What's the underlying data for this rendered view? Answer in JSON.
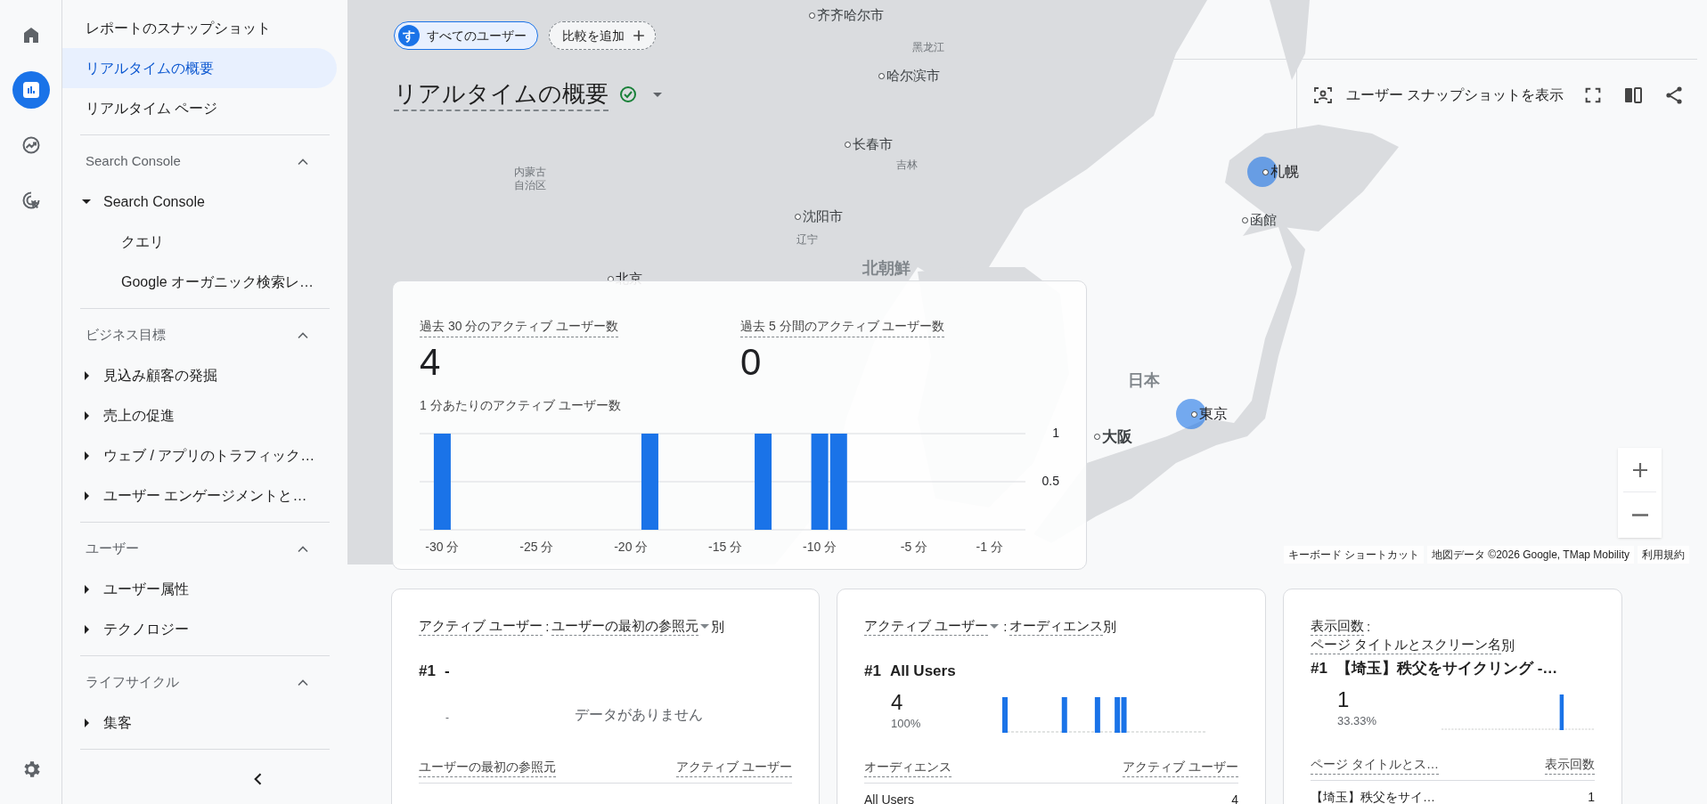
{
  "rail": {
    "items": [
      {
        "selected": false
      },
      {
        "selected": true
      },
      {
        "selected": false
      },
      {
        "selected": false
      },
      {
        "selected": false
      }
    ]
  },
  "nav": {
    "top_items": [
      {
        "label": "レポートのスナップショット",
        "selected": false
      },
      {
        "label": "リアルタイムの概要",
        "selected": true
      },
      {
        "label": "リアルタイム ページ",
        "selected": false
      }
    ],
    "sections": [
      {
        "title": "Search Console",
        "expanded": true,
        "items": [
          {
            "label": "Search Console",
            "expanded": true,
            "children": [
              {
                "label": "クエリ"
              },
              {
                "label": "Google オーガニック検索レ…"
              }
            ]
          }
        ]
      },
      {
        "title": "ビジネス目標",
        "expanded": true,
        "items": [
          {
            "label": "見込み顧客の発掘",
            "expanded": false
          },
          {
            "label": "売上の促進",
            "expanded": false
          },
          {
            "label": "ウェブ / アプリのトラフィック…",
            "expanded": false
          },
          {
            "label": "ユーザー エンゲージメントと…",
            "expanded": false
          }
        ]
      },
      {
        "title": "ユーザー",
        "expanded": true,
        "items": [
          {
            "label": "ユーザー属性",
            "expanded": false
          },
          {
            "label": "テクノロジー",
            "expanded": false
          }
        ]
      },
      {
        "title": "ライフサイクル",
        "expanded": true,
        "items": [
          {
            "label": "集客",
            "expanded": false
          }
        ]
      }
    ]
  },
  "header": {
    "segment": {
      "avatar_letter": "す",
      "label": "すべてのユーザー"
    },
    "add_comparison": "比較を追加",
    "title": "リアルタイムの概要",
    "user_snapshot": "ユーザー スナップショットを表示"
  },
  "map": {
    "labels": [
      {
        "text": "齐齐哈尔市",
        "kind": "city"
      },
      {
        "text": "黑龙江",
        "kind": "region"
      },
      {
        "text": "哈尔滨市",
        "kind": "city"
      },
      {
        "text": "长春市",
        "kind": "city"
      },
      {
        "text": "吉林",
        "kind": "region"
      },
      {
        "text": "内蒙古自治区",
        "kind": "region"
      },
      {
        "text": "沈阳市",
        "kind": "city"
      },
      {
        "text": "辽宁",
        "kind": "region"
      },
      {
        "text": "北京",
        "kind": "capital"
      },
      {
        "text": "北朝鮮",
        "kind": "country"
      },
      {
        "text": "札幌",
        "kind": "active_city"
      },
      {
        "text": "函館",
        "kind": "city"
      },
      {
        "text": "日本",
        "kind": "country"
      },
      {
        "text": "東京",
        "kind": "active_city"
      },
      {
        "text": "大阪",
        "kind": "major_city"
      }
    ],
    "attribution": [
      "キーボード ショートカット",
      "地図データ ©2026 Google, TMap Mobility",
      "利用規約"
    ]
  },
  "realtime_card": {
    "metrics": [
      {
        "label": "過去 30 分のアクティブ ユーザー数",
        "value": "4"
      },
      {
        "label": "過去 5 分間のアクティブ ユーザー数",
        "value": "0"
      }
    ],
    "chart_title": "1 分あたりのアクティブ ユーザー数",
    "chart_data": {
      "type": "bar",
      "x": [
        -30,
        -29,
        -28,
        -27,
        -26,
        -25,
        -24,
        -23,
        -22,
        -21,
        -20,
        -19,
        -18,
        -17,
        -16,
        -15,
        -14,
        -13,
        -12,
        -11,
        -10,
        -9,
        -8,
        -7,
        -6,
        -5,
        -4,
        -3,
        -2,
        -1
      ],
      "values": [
        1,
        0,
        0,
        0,
        0,
        0,
        0,
        0,
        0,
        0,
        0,
        1,
        0,
        0,
        0,
        0,
        0,
        1,
        0,
        0,
        1,
        1,
        0,
        0,
        0,
        0,
        0,
        0,
        0,
        0
      ],
      "xlim": [
        -31.2,
        0.9
      ],
      "ylim": [
        0,
        1
      ],
      "yticks": [
        {
          "value": 0.5,
          "label": "0.5"
        },
        {
          "value": 1,
          "label": "1"
        }
      ],
      "xticks": [
        {
          "value": -30,
          "label": "-30 分"
        },
        {
          "value": -25,
          "label": "-25 分"
        },
        {
          "value": -20,
          "label": "-20 分"
        },
        {
          "value": -15,
          "label": "-15 分"
        },
        {
          "value": -10,
          "label": "-10 分"
        },
        {
          "value": -5,
          "label": "-5 分"
        },
        {
          "value": -1,
          "label": "-1 分"
        }
      ]
    }
  },
  "cards": [
    {
      "metric": "アクティブ ユーザー",
      "separator": ":",
      "dimension": "ユーザーの最初の参照元",
      "suffix": "別",
      "metric_dropdown": false,
      "dimension_dropdown": true,
      "sparkline": false,
      "rank": "#1",
      "top_name": "-",
      "top_value": "-",
      "empty_text": "データがありません",
      "columns": [
        "ユーザーの最初の参照元",
        "アクティブ ユーザー"
      ]
    },
    {
      "metric": "アクティブ ユーザー",
      "separator": ":",
      "dimension": "オーディエンス",
      "suffix": "別",
      "metric_dropdown": true,
      "dimension_dropdown": false,
      "rank": "#1",
      "top_name": "All Users",
      "top_value": "4",
      "top_share": "100%",
      "sparkline": true,
      "columns": [
        "オーディエンス",
        "アクティブ ユーザー"
      ],
      "rows": [
        [
          "All Users",
          "4"
        ]
      ]
    },
    {
      "metric": "表示回数",
      "separator": ":",
      "dimension": "ページ タイトルとスクリーン名",
      "suffix": "別",
      "metric_dropdown": false,
      "dimension_dropdown": false,
      "rank": "#1",
      "top_name": "【埼玉】秩父をサイクリング -…",
      "top_value": "1",
      "top_share": "33.33%",
      "sparkline": true,
      "columns": [
        "ページ タイトルとス…",
        "表示回数"
      ],
      "rows": [
        [
          "【埼玉】秩父をサイ…",
          "1"
        ]
      ]
    }
  ]
}
